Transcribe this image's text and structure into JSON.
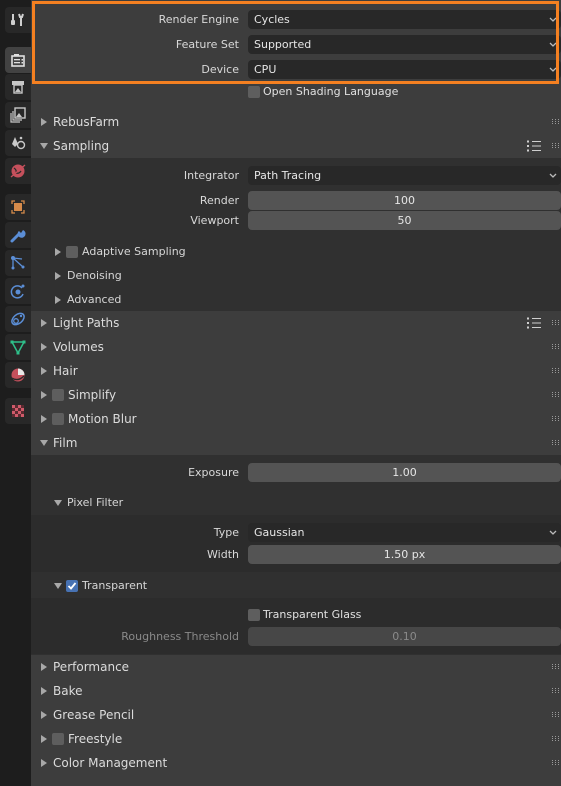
{
  "tabs": [
    {
      "name": "tool",
      "icon": "tool-icon",
      "active": false
    },
    {
      "name": "render",
      "icon": "render-camera-icon",
      "active": true
    },
    {
      "name": "output",
      "icon": "output-printer-icon",
      "active": false
    },
    {
      "name": "view-layer",
      "icon": "view-layer-icon",
      "active": false
    },
    {
      "name": "scene",
      "icon": "scene-icon",
      "active": false
    },
    {
      "name": "world",
      "icon": "world-icon",
      "active": false
    },
    {
      "name": "object",
      "icon": "object-icon",
      "active": false
    },
    {
      "name": "modifiers",
      "icon": "wrench-icon",
      "active": false
    },
    {
      "name": "particles",
      "icon": "particles-icon",
      "active": false
    },
    {
      "name": "physics",
      "icon": "physics-icon",
      "active": false
    },
    {
      "name": "constraints",
      "icon": "constraints-icon",
      "active": false
    },
    {
      "name": "data",
      "icon": "mesh-data-icon",
      "active": false
    },
    {
      "name": "material",
      "icon": "material-icon",
      "active": false
    },
    {
      "name": "texture",
      "icon": "texture-checker-icon",
      "active": false
    }
  ],
  "render_settings": {
    "render_engine": {
      "label": "Render Engine",
      "value": "Cycles"
    },
    "feature_set": {
      "label": "Feature Set",
      "value": "Supported"
    },
    "device": {
      "label": "Device",
      "value": "CPU"
    },
    "osl": {
      "label": "Open Shading Language",
      "checked": false
    }
  },
  "panels": {
    "rebusfarm": {
      "title": "RebusFarm",
      "expanded": false
    },
    "sampling": {
      "title": "Sampling",
      "expanded": true,
      "integrator": {
        "label": "Integrator",
        "value": "Path Tracing"
      },
      "render": {
        "label": "Render",
        "value": "100"
      },
      "viewport": {
        "label": "Viewport",
        "value": "50"
      },
      "adaptive_sampling": {
        "title": "Adaptive Sampling",
        "checked": false,
        "expanded": false
      },
      "denoising": {
        "title": "Denoising",
        "expanded": false
      },
      "advanced": {
        "title": "Advanced",
        "expanded": false
      }
    },
    "light_paths": {
      "title": "Light Paths",
      "expanded": false
    },
    "volumes": {
      "title": "Volumes",
      "expanded": false
    },
    "hair": {
      "title": "Hair",
      "expanded": false
    },
    "simplify": {
      "title": "Simplify",
      "checked": false,
      "expanded": false
    },
    "motion_blur": {
      "title": "Motion Blur",
      "checked": false,
      "expanded": false
    },
    "film": {
      "title": "Film",
      "expanded": true,
      "exposure": {
        "label": "Exposure",
        "value": "1.00"
      },
      "pixel_filter": {
        "title": "Pixel Filter",
        "expanded": true,
        "type": {
          "label": "Type",
          "value": "Gaussian"
        },
        "width": {
          "label": "Width",
          "value": "1.50 px"
        }
      },
      "transparent": {
        "title": "Transparent",
        "checked": true,
        "expanded": true,
        "transparent_glass": {
          "label": "Transparent Glass",
          "checked": false
        },
        "roughness_threshold": {
          "label": "Roughness Threshold",
          "value": "0.10"
        }
      }
    },
    "performance": {
      "title": "Performance",
      "expanded": false
    },
    "bake": {
      "title": "Bake",
      "expanded": false
    },
    "grease_pencil": {
      "title": "Grease Pencil",
      "expanded": false
    },
    "freestyle": {
      "title": "Freestyle",
      "checked": false,
      "expanded": false
    },
    "color_management": {
      "title": "Color Management",
      "expanded": false
    }
  },
  "colors": {
    "highlight": "#f48021",
    "checkbox_checked": "#4772b3"
  }
}
